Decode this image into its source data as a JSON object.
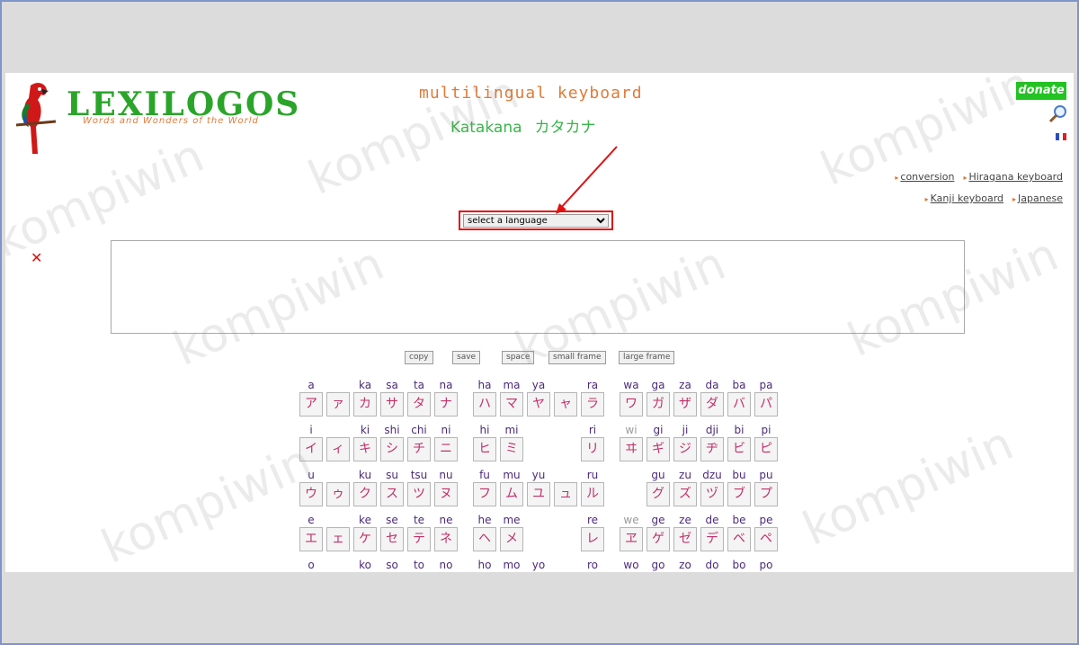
{
  "header": {
    "logo_title": "LEXILOGOS",
    "logo_subtitle": "Words and Wonders of the World",
    "title": "multilingual keyboard",
    "subtitle": "Katakana",
    "subtitle_kana": "カタカナ",
    "donate_label": "donate"
  },
  "links": [
    {
      "label": "conversion"
    },
    {
      "label": "Hiragana keyboard"
    },
    {
      "label": "Kanji keyboard"
    },
    {
      "label": "Japanese"
    }
  ],
  "language_select": {
    "selected": "select a language"
  },
  "buttons": {
    "copy": "copy",
    "save": "save",
    "space": "space",
    "small_frame": "small frame",
    "large_frame": "large frame"
  },
  "keyboard": {
    "rows": [
      {
        "cells": [
          [
            "a",
            "ア"
          ],
          [
            "",
            "ァ"
          ],
          [
            "ka",
            "カ"
          ],
          [
            "sa",
            "サ"
          ],
          [
            "ta",
            "タ"
          ],
          [
            "na",
            "ナ"
          ],
          [
            "ha",
            "ハ"
          ],
          [
            "ma",
            "マ"
          ],
          [
            "ya",
            "ヤ"
          ],
          [
            "",
            "ャ"
          ],
          [
            "ra",
            "ラ"
          ],
          [
            "wa",
            "ワ"
          ],
          [
            "ga",
            "ガ"
          ],
          [
            "za",
            "ザ"
          ],
          [
            "da",
            "ダ"
          ],
          [
            "ba",
            "バ"
          ],
          [
            "pa",
            "パ"
          ]
        ]
      },
      {
        "cells": [
          [
            "i",
            "イ"
          ],
          [
            "",
            "ィ"
          ],
          [
            "ki",
            "キ"
          ],
          [
            "shi",
            "シ"
          ],
          [
            "chi",
            "チ"
          ],
          [
            "ni",
            "ニ"
          ],
          [
            "hi",
            "ヒ"
          ],
          [
            "mi",
            "ミ"
          ],
          null,
          null,
          [
            "ri",
            "リ"
          ],
          [
            "wi",
            "ヰ"
          ],
          [
            "gi",
            "ギ"
          ],
          [
            "ji",
            "ジ"
          ],
          [
            "dji",
            "ヂ"
          ],
          [
            "bi",
            "ビ"
          ],
          [
            "pi",
            "ピ"
          ]
        ]
      },
      {
        "cells": [
          [
            "u",
            "ウ"
          ],
          [
            "",
            "ゥ"
          ],
          [
            "ku",
            "ク"
          ],
          [
            "su",
            "ス"
          ],
          [
            "tsu",
            "ツ"
          ],
          [
            "nu",
            "ヌ"
          ],
          [
            "fu",
            "フ"
          ],
          [
            "mu",
            "ム"
          ],
          [
            "yu",
            "ユ"
          ],
          [
            "",
            "ュ"
          ],
          [
            "ru",
            "ル"
          ],
          null,
          [
            "gu",
            "グ"
          ],
          [
            "zu",
            "ズ"
          ],
          [
            "dzu",
            "ヅ"
          ],
          [
            "bu",
            "ブ"
          ],
          [
            "pu",
            "プ"
          ]
        ]
      },
      {
        "cells": [
          [
            "e",
            "エ"
          ],
          [
            "",
            "ェ"
          ],
          [
            "ke",
            "ケ"
          ],
          [
            "se",
            "セ"
          ],
          [
            "te",
            "テ"
          ],
          [
            "ne",
            "ネ"
          ],
          [
            "he",
            "ヘ"
          ],
          [
            "me",
            "メ"
          ],
          null,
          null,
          [
            "re",
            "レ"
          ],
          [
            "we",
            "ヱ"
          ],
          [
            "ge",
            "ゲ"
          ],
          [
            "ze",
            "ゼ"
          ],
          [
            "de",
            "デ"
          ],
          [
            "be",
            "ベ"
          ],
          [
            "pe",
            "ペ"
          ]
        ]
      },
      {
        "cells": [
          [
            "o",
            ""
          ],
          null,
          [
            "ko",
            ""
          ],
          [
            "so",
            ""
          ],
          [
            "to",
            ""
          ],
          [
            "no",
            ""
          ],
          [
            "ho",
            ""
          ],
          [
            "mo",
            ""
          ],
          [
            "yo",
            ""
          ],
          null,
          [
            "ro",
            ""
          ],
          [
            "wo",
            ""
          ],
          [
            "go",
            ""
          ],
          [
            "zo",
            ""
          ],
          [
            "do",
            ""
          ],
          [
            "bo",
            ""
          ],
          [
            "po",
            ""
          ]
        ]
      }
    ]
  },
  "watermark": "kompiwin",
  "colors": {
    "accent_green": "#3bb54a",
    "accent_orange": "#e07b3a",
    "highlight_red": "#e01010",
    "kana_color": "#c0306a",
    "romaji_color": "#4c2a7a"
  }
}
